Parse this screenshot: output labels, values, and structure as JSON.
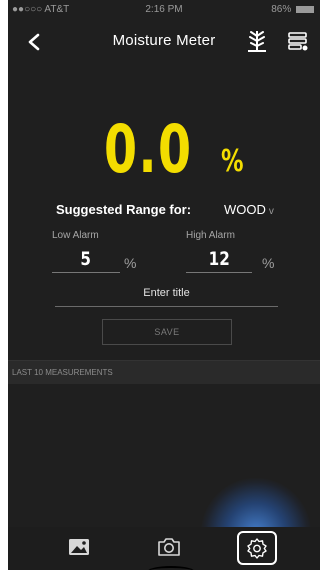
{
  "status_bar": {
    "carrier": "●●○○○ AT&T",
    "time": "2:16 PM",
    "battery": "86%"
  },
  "nav": {
    "title": "Moisture Meter"
  },
  "reading": {
    "value": "0.0",
    "unit": "%"
  },
  "range": {
    "label": "Suggested Range for:",
    "selected": "WOOD",
    "chevron": "v"
  },
  "alarms": {
    "low_label": "Low Alarm",
    "low_value": "5",
    "low_unit": "%",
    "high_label": "High Alarm",
    "high_value": "12",
    "high_unit": "%"
  },
  "title_input": {
    "placeholder": "Enter title"
  },
  "save": {
    "label": "SAVE"
  },
  "measurements": {
    "header": "LAST 10 MEASUREMENTS"
  },
  "colors": {
    "accent": "#f3dd00",
    "background": "#1f1f1f",
    "tab_glow": "#4682d2"
  },
  "icons": {
    "back": "chevron-left-icon",
    "wood": "wood-grain-icon",
    "list": "measurement-list-icon",
    "gallery": "gallery-icon",
    "camera": "camera-icon",
    "settings": "settings-gear-icon"
  }
}
